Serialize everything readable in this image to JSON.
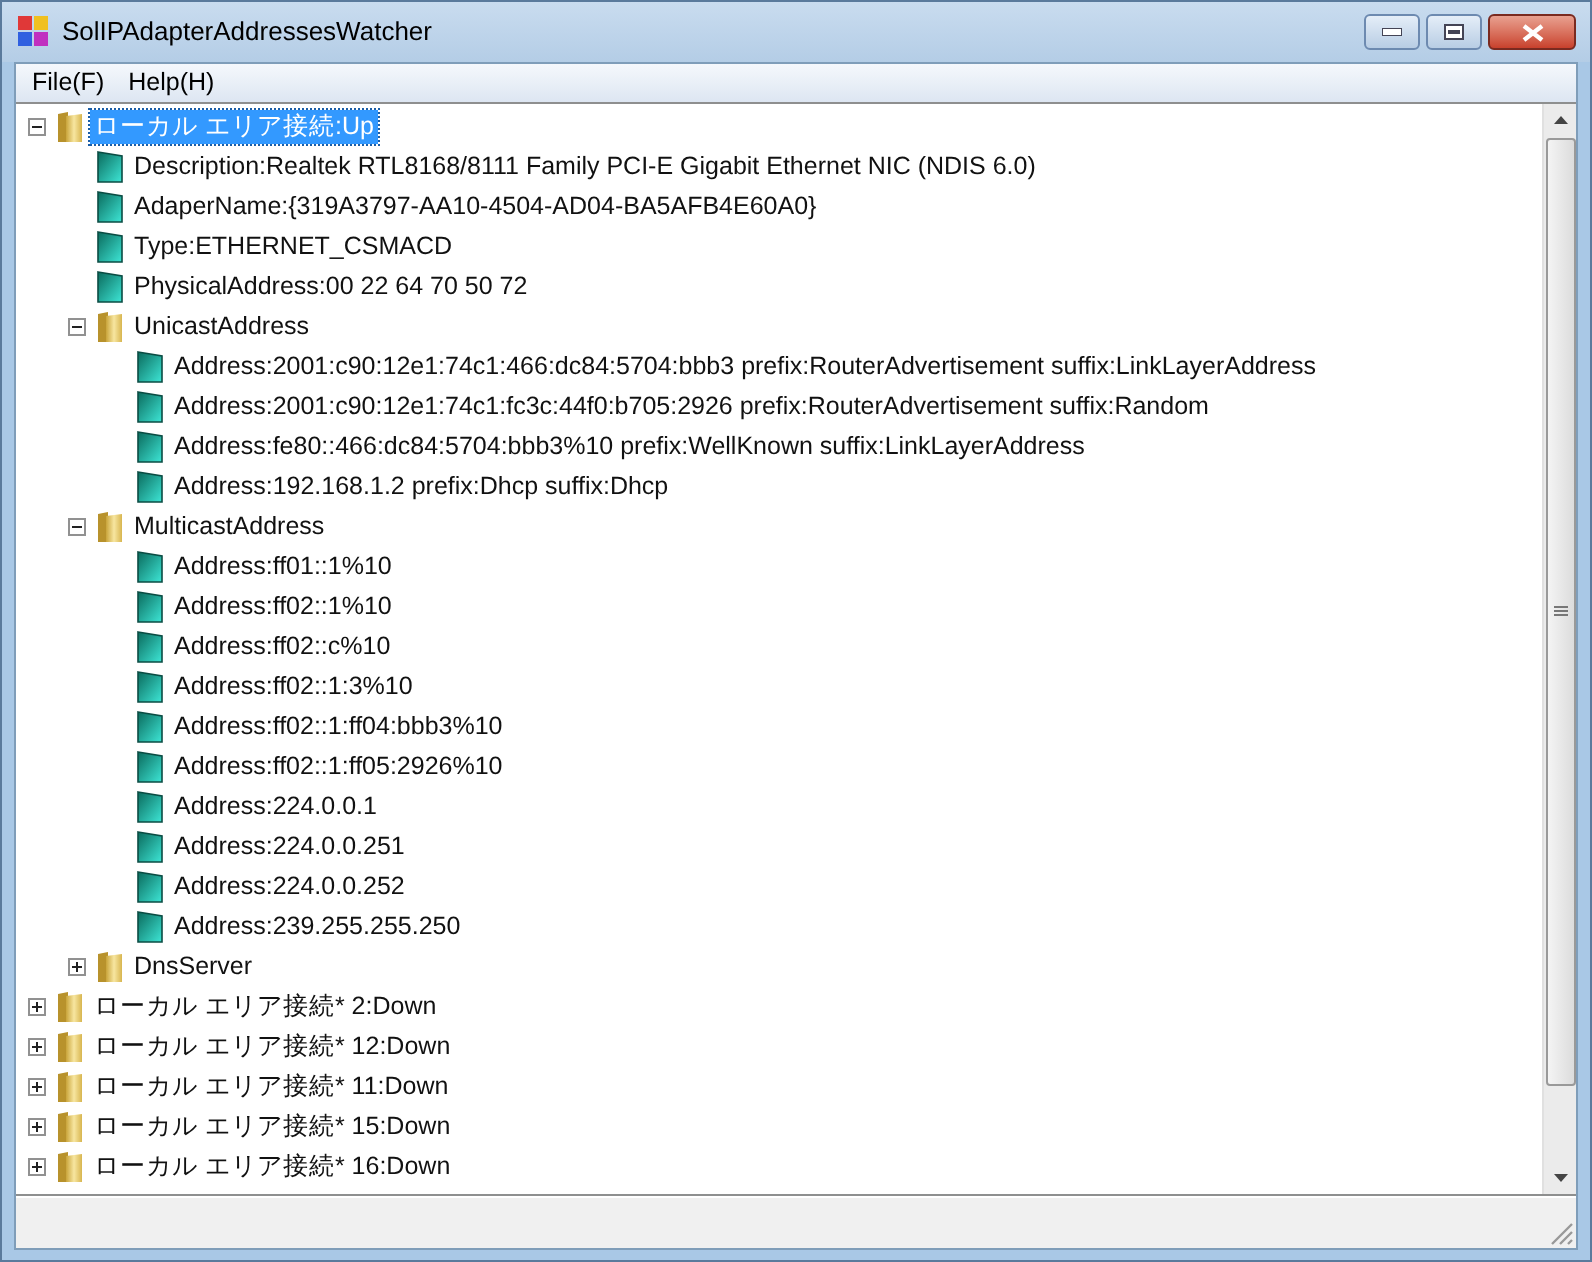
{
  "window": {
    "title": "SolIPAdapterAddressesWatcher"
  },
  "menu": [
    "File(F)",
    "Help(H)"
  ],
  "tree": [
    {
      "label": "ローカル エリア接続:Up",
      "kind": "folder",
      "expanded": true,
      "selected": true,
      "children": [
        {
          "label": "Description:Realtek RTL8168/8111 Family PCI-E Gigabit Ethernet NIC (NDIS 6.0)",
          "kind": "item",
          "selected": false
        },
        {
          "label": "AdaperName:{319A3797-AA10-4504-AD04-BA5AFB4E60A0}",
          "kind": "item",
          "selected": false
        },
        {
          "label": "Type:ETHERNET_CSMACD",
          "kind": "item",
          "selected": false
        },
        {
          "label": "PhysicalAddress:00 22 64 70 50 72",
          "kind": "item",
          "selected": false
        },
        {
          "label": "UnicastAddress",
          "kind": "folder",
          "expanded": true,
          "selected": false,
          "children": [
            {
              "label": "Address:2001:c90:12e1:74c1:466:dc84:5704:bbb3 prefix:RouterAdvertisement suffix:LinkLayerAddress",
              "kind": "item",
              "selected": false
            },
            {
              "label": "Address:2001:c90:12e1:74c1:fc3c:44f0:b705:2926 prefix:RouterAdvertisement suffix:Random",
              "kind": "item",
              "selected": false
            },
            {
              "label": "Address:fe80::466:dc84:5704:bbb3%10 prefix:WellKnown suffix:LinkLayerAddress",
              "kind": "item",
              "selected": false
            },
            {
              "label": "Address:192.168.1.2 prefix:Dhcp suffix:Dhcp",
              "kind": "item",
              "selected": false
            }
          ]
        },
        {
          "label": "MulticastAddress",
          "kind": "folder",
          "expanded": true,
          "selected": false,
          "children": [
            {
              "label": "Address:ff01::1%10",
              "kind": "item",
              "selected": false
            },
            {
              "label": "Address:ff02::1%10",
              "kind": "item",
              "selected": false
            },
            {
              "label": "Address:ff02::c%10",
              "kind": "item",
              "selected": false
            },
            {
              "label": "Address:ff02::1:3%10",
              "kind": "item",
              "selected": false
            },
            {
              "label": "Address:ff02::1:ff04:bbb3%10",
              "kind": "item",
              "selected": false
            },
            {
              "label": "Address:ff02::1:ff05:2926%10",
              "kind": "item",
              "selected": false
            },
            {
              "label": "Address:224.0.0.1",
              "kind": "item",
              "selected": false
            },
            {
              "label": "Address:224.0.0.251",
              "kind": "item",
              "selected": false
            },
            {
              "label": "Address:224.0.0.252",
              "kind": "item",
              "selected": false
            },
            {
              "label": "Address:239.255.255.250",
              "kind": "item",
              "selected": false
            }
          ]
        },
        {
          "label": "DnsServer",
          "kind": "folder",
          "expanded": false,
          "selected": false
        }
      ]
    },
    {
      "label": "ローカル エリア接続* 2:Down",
      "kind": "folder",
      "expanded": false,
      "selected": false
    },
    {
      "label": "ローカル エリア接続* 12:Down",
      "kind": "folder",
      "expanded": false,
      "selected": false
    },
    {
      "label": "ローカル エリア接続* 11:Down",
      "kind": "folder",
      "expanded": false,
      "selected": false
    },
    {
      "label": "ローカル エリア接続* 15:Down",
      "kind": "folder",
      "expanded": false,
      "selected": false
    },
    {
      "label": "ローカル エリア接続* 16:Down",
      "kind": "folder",
      "expanded": false,
      "selected": false
    }
  ]
}
